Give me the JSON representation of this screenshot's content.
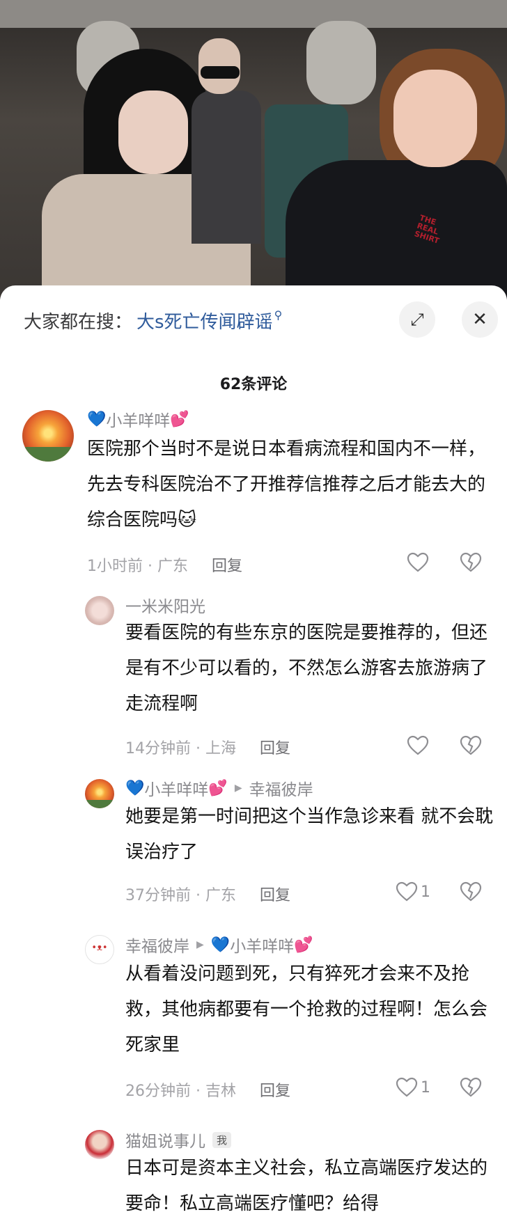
{
  "search": {
    "prefix": "大家都在搜：",
    "term": "大s死亡传闻辟谣",
    "search_glyph": "⚲",
    "expand_glyph": "⤢",
    "close_glyph": "✕"
  },
  "video": {
    "shirt_text": "THE\nREAL\nSHIRT"
  },
  "comment_count": "62条评论",
  "comments": [
    {
      "name": "小羊咩咩",
      "text": "医院那个当时不是说日本看病流程和国内不一样，先去专科医院治不了开推荐信推荐之后才能去大的综合医院吗",
      "emoji": "🐱",
      "time": "1小时前 · 广东",
      "reply": "回复",
      "likes": ""
    },
    {
      "name": "一米米阳光",
      "text": "要看医院的有些东京的医院是要推荐的，但还是有不少可以看的，不然怎么游客去旅游病了走流程啊",
      "time": "14分钟前 · 上海",
      "reply": "回复",
      "likes": ""
    },
    {
      "name": "小羊咩咩",
      "reply_to": "幸福彼岸",
      "text": "她要是第一时间把这个当作急诊来看 就不会耽误治疗了",
      "time": "37分钟前 · 广东",
      "reply": "回复",
      "likes": "1"
    },
    {
      "name": "幸福彼岸",
      "reply_to": "小羊咩咩",
      "text": "从看着没问题到死，只有猝死才会来不及抢救，其他病都要有一个抢救的过程啊！怎么会死家里",
      "time": "26分钟前 · 吉林",
      "reply": "回复",
      "likes": "1"
    },
    {
      "name": "猫姐说事儿",
      "badge": "我",
      "text": "日本可是资本主义社会，私立高端医疗发达的要命！私立高端医疗懂吧？给得",
      "time": "",
      "reply": ""
    }
  ],
  "glyphs": {
    "heart_blue": "💙",
    "heart_pink": "💕",
    "arrow": "▶"
  },
  "colors": {
    "link_blue": "#2f5b9b",
    "meta_gray": "#a3a3a7",
    "sheet_bg": "#ffffff"
  }
}
